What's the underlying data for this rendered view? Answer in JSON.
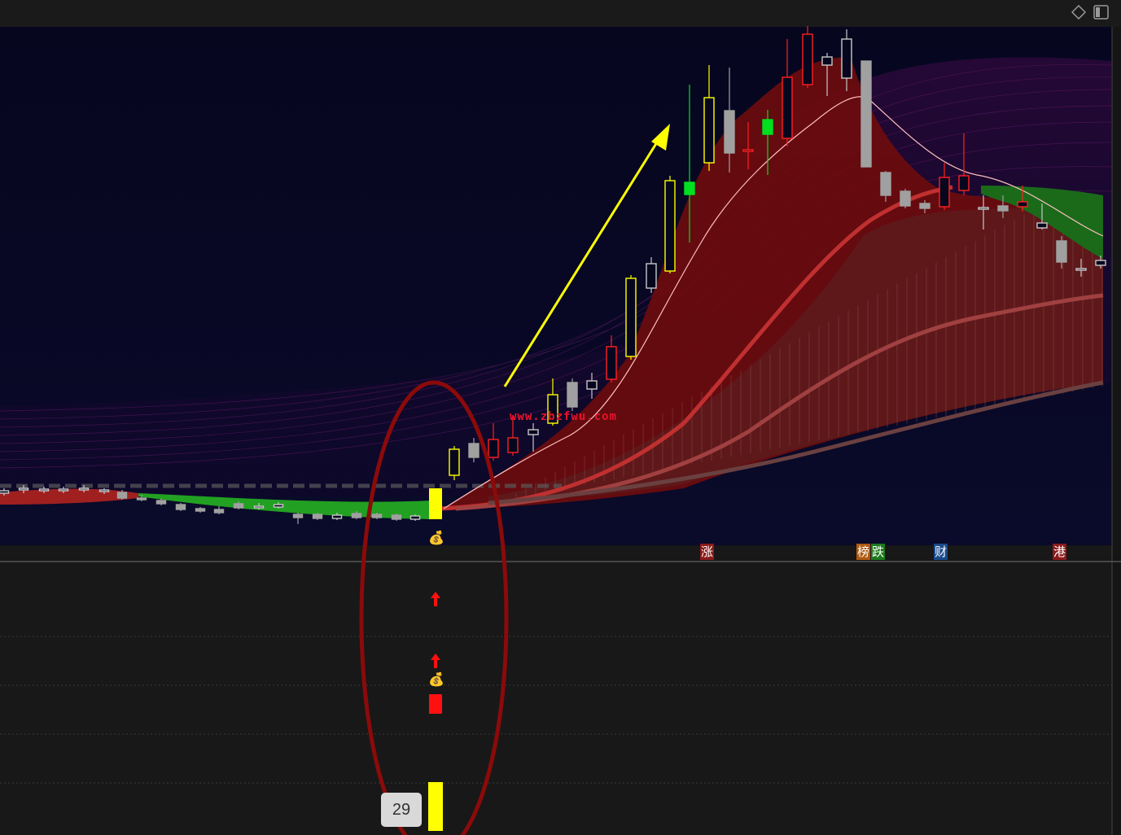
{
  "toolbar": {
    "diamond_icon": "diamond-icon",
    "panel_icon": "panel-toggle-icon"
  },
  "watermark": "www.zbzfwu.com",
  "event_tags": [
    {
      "text": "涨",
      "bg": "#8b1a1a"
    },
    {
      "text": "榜",
      "bg": "#b05a10"
    },
    {
      "text": "跌",
      "bg": "#1d7a1d"
    },
    {
      "text": "财",
      "bg": "#1a4a8a"
    },
    {
      "text": "港",
      "bg": "#8b1a1a"
    }
  ],
  "date_label": "29",
  "icons": [
    "money-bag-icon",
    "up-arrow-icon"
  ],
  "colors": {
    "up_yellow": "#ffff00",
    "up_red": "#ff2020",
    "down_gray": "#a0a0a0",
    "green_cloud": "#1f8a1f",
    "red_cloud": "#7a1010",
    "highlight_ellipse": "#8b0a0a",
    "arrow": "#ffff00"
  }
}
